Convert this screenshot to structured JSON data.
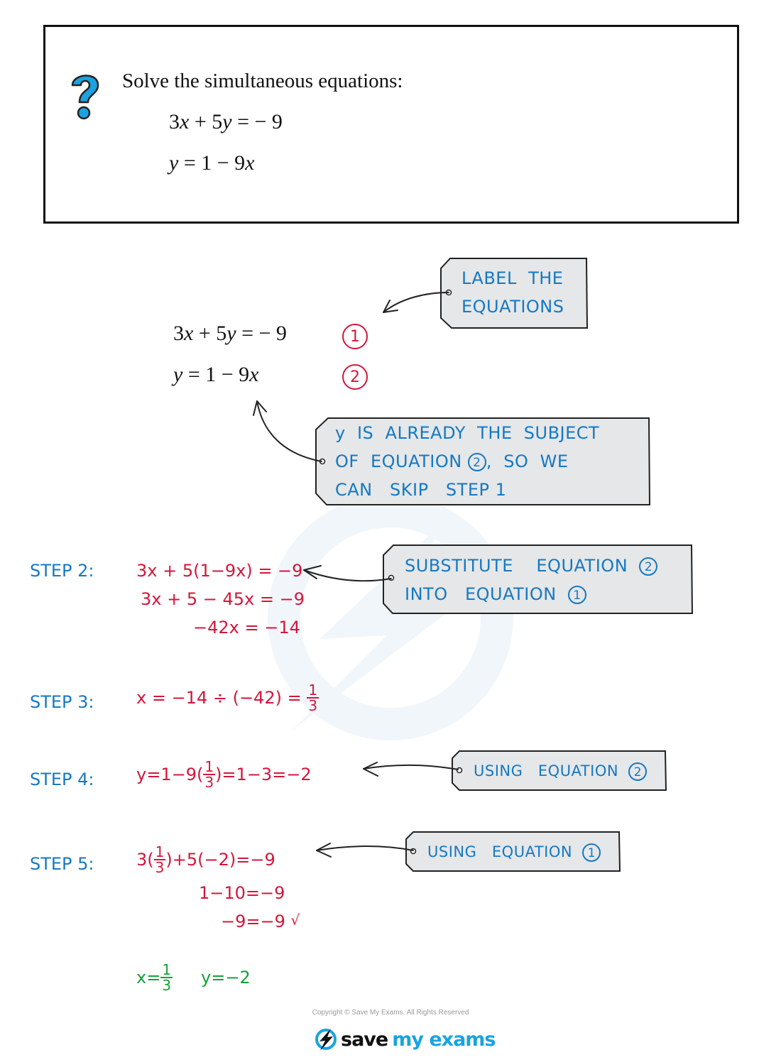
{
  "question": {
    "icon": "question-mark-icon",
    "prompt": "Solve the simultaneous equations:",
    "equations": [
      {
        "parts": [
          "3",
          "x",
          " + 5",
          "y",
          " = − 9"
        ]
      },
      {
        "parts": [
          "y",
          " = 1 − 9",
          "x"
        ]
      }
    ]
  },
  "labelled_equations": [
    {
      "parts": [
        "3",
        "x",
        " + 5",
        "y",
        " = − 9"
      ],
      "label": "1"
    },
    {
      "parts": [
        "y",
        " = 1 − 9",
        "x"
      ],
      "label": "2"
    }
  ],
  "annotations": {
    "label_the_equations": [
      "LABEL  THE",
      "EQUATIONS"
    ],
    "y_subject": {
      "line1": "y  IS  ALREADY  THE  SUBJECT",
      "line2_pre": "OF  EQUATION ",
      "line2_circ": "2",
      "line2_post": ",  SO  WE",
      "line3": "CAN   SKIP   STEP 1"
    },
    "substitute": {
      "line1_pre": "SUBSTITUTE    EQUATION  ",
      "line1_circ": "2",
      "line2_pre": "INTO   EQUATION  ",
      "line2_circ": "1"
    },
    "using_eq2": {
      "text": "USING   EQUATION  ",
      "circ": "2"
    },
    "using_eq1": {
      "text": "USING   EQUATION  ",
      "circ": "1"
    }
  },
  "steps": {
    "step2": {
      "label": "STEP  2:",
      "lines": [
        "3x + 5(1−9x) = −9",
        "3x + 5 − 45x = −9",
        "−42x = −14"
      ]
    },
    "step3": {
      "label": "STEP  3:",
      "expr": "x = −14 ÷ (−42) = ",
      "frac_num": "1",
      "frac_den": "3"
    },
    "step4": {
      "label": "STEP  4:",
      "expr_pre": "y=1−9(",
      "frac_num": "1",
      "frac_den": "3",
      "expr_post": ")=1−3=−2"
    },
    "step5": {
      "label": "STEP  5:",
      "line1_pre": "3(",
      "frac_num": "1",
      "frac_den": "3",
      "line1_post": ")+5(−2)=−9",
      "line2": "1−10=−9",
      "line3": "−9=−9",
      "check": "√"
    }
  },
  "answer": {
    "x_pre": "x=",
    "x_num": "1",
    "x_den": "3",
    "y": "y=−2"
  },
  "footer": {
    "copyright": "Copyright © Save My Exams. All Rights Reserved",
    "logo_word_a": "save",
    "logo_word_b": "my exams"
  },
  "colors": {
    "annotation_blue": "#1479c4",
    "working_red": "#d4163c",
    "answer_green": "#17a03a",
    "tag_fill": "#e6e7e8",
    "brand_blue": "#1aa3e0"
  }
}
